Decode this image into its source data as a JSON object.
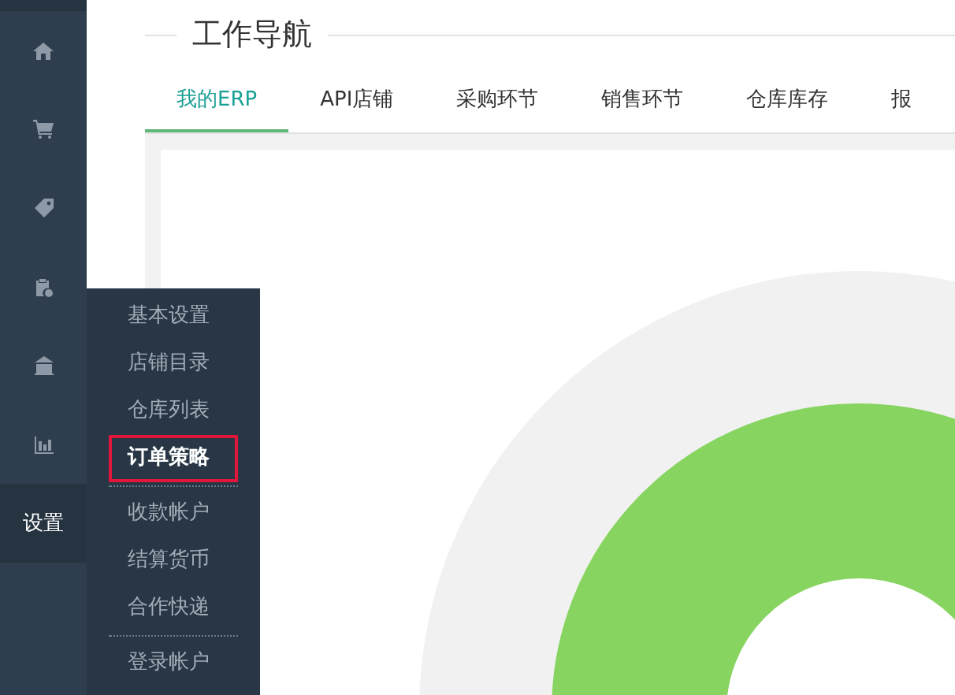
{
  "sidebar": {
    "items": [
      {
        "selected": false
      },
      {
        "selected": false
      },
      {
        "selected": false
      },
      {
        "selected": false
      },
      {
        "selected": false
      },
      {
        "selected": false
      },
      {
        "label": "设置",
        "selected": true
      }
    ]
  },
  "flyout_menu": {
    "items": [
      {
        "kind": "item",
        "label": "基本设置",
        "selected": false
      },
      {
        "kind": "item",
        "label": "店铺目录",
        "selected": false
      },
      {
        "kind": "item",
        "label": "仓库列表",
        "selected": false
      },
      {
        "kind": "item",
        "label": "订单策略",
        "selected": true
      },
      {
        "kind": "divider"
      },
      {
        "kind": "item",
        "label": "收款帐户",
        "selected": false
      },
      {
        "kind": "item",
        "label": "结算货币",
        "selected": false
      },
      {
        "kind": "item",
        "label": "合作快递",
        "selected": false
      },
      {
        "kind": "divider"
      },
      {
        "kind": "item",
        "label": "登录帐户",
        "selected": false
      }
    ]
  },
  "section_title": "工作导航",
  "tabs": [
    {
      "label": "我的ERP",
      "selected": true
    },
    {
      "label": "API店铺",
      "selected": false
    },
    {
      "label": "采购环节",
      "selected": false
    },
    {
      "label": "销售环节",
      "selected": false
    },
    {
      "label": "仓库库存",
      "selected": false
    },
    {
      "label": "报",
      "selected": false
    }
  ]
}
